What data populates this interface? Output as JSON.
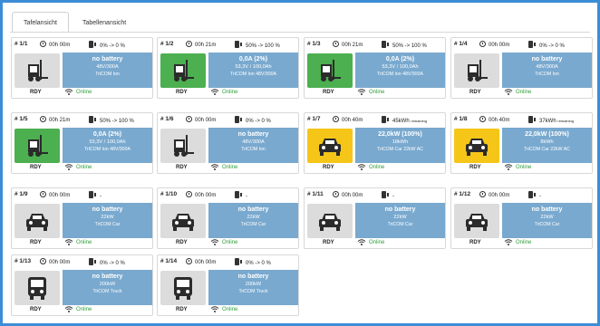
{
  "tabs": [
    {
      "label": "Tafelansicht",
      "active": true
    },
    {
      "label": "Tabellenansicht",
      "active": false
    }
  ],
  "colors": {
    "info_panel": "#79a9cf",
    "online": "#2e9e3a",
    "thumb_green": "#4caf50",
    "thumb_yellow": "#f5c518",
    "thumb_gray": "#dcdcdc",
    "frame": "#3c8dd6"
  },
  "cards": [
    {
      "id": "1/1",
      "time": "00h 00m",
      "charge": "0% -> 0 %",
      "rem": "",
      "vehicle": "forklift-icon",
      "thumb": "gray",
      "l1": "no battery",
      "l2": "48V/300A",
      "l3": "TriCOM Ion",
      "status": "RDY",
      "online": "Online"
    },
    {
      "id": "1/2",
      "time": "00h 21m",
      "charge": "50% -> 100 %",
      "rem": "",
      "vehicle": "forklift-icon",
      "thumb": "green",
      "l1": "0,0A (2%)",
      "l2": "53,3V / 100,0Ah",
      "l3": "TriCOM Ion 48V/300A",
      "status": "RDY",
      "online": "Online"
    },
    {
      "id": "1/3",
      "time": "00h 21m",
      "charge": "50% -> 100 %",
      "rem": "",
      "vehicle": "forklift-icon",
      "thumb": "green",
      "l1": "0,0A (2%)",
      "l2": "53,3V / 100,0Ah",
      "l3": "TriCOM Ion 48V/300A",
      "status": "RDY",
      "online": "Online"
    },
    {
      "id": "1/4",
      "time": "00h 00m",
      "charge": "0% -> 0 %",
      "rem": "",
      "vehicle": "forklift-icon",
      "thumb": "gray",
      "l1": "no battery",
      "l2": "48V/300A",
      "l3": "TriCOM Ion",
      "status": "RDY",
      "online": "Online"
    },
    {
      "id": "1/5",
      "time": "00h 21m",
      "charge": "50% -> 100 %",
      "rem": "",
      "vehicle": "forklift-icon",
      "thumb": "green",
      "l1": "0,0A (2%)",
      "l2": "53,3V / 100,0Ah",
      "l3": "TriCOM Ion 48V/300A",
      "status": "RDY",
      "online": "Online"
    },
    {
      "id": "1/6",
      "time": "00h 00m",
      "charge": "0% -> 0 %",
      "rem": "",
      "vehicle": "forklift-icon",
      "thumb": "gray",
      "l1": "no battery",
      "l2": "48V/300A",
      "l3": "TriCOM Ion",
      "status": "RDY",
      "online": "Online"
    },
    {
      "id": "1/7",
      "time": "00h 40m",
      "charge": "45kWh",
      "rem": "remaining",
      "vehicle": "car-icon",
      "thumb": "yellow",
      "l1": "22,0kW (100%)",
      "l2": "18kWh",
      "l3": "TriCOM Car 22kW AC",
      "status": "RDY",
      "online": "Online"
    },
    {
      "id": "1/8",
      "time": "00h 40m",
      "charge": "37kWh",
      "rem": "remaining",
      "vehicle": "car-icon",
      "thumb": "yellow",
      "l1": "22,0kW (100%)",
      "l2": "8kWh",
      "l3": "TriCOM Car 22kW AC",
      "status": "RDY",
      "online": "Online"
    },
    {
      "id": "1/9",
      "time": "00h 00m",
      "charge": "-",
      "rem": "",
      "vehicle": "car-icon",
      "thumb": "gray",
      "l1": "no battery",
      "l2": "22kW",
      "l3": "TriCOM Car",
      "status": "RDY",
      "online": "Online"
    },
    {
      "id": "1/10",
      "time": "00h 00m",
      "charge": "-",
      "rem": "",
      "vehicle": "car-icon",
      "thumb": "gray",
      "l1": "no battery",
      "l2": "22kW",
      "l3": "TriCOM Car",
      "status": "RDY",
      "online": "Online"
    },
    {
      "id": "1/11",
      "time": "00h 00m",
      "charge": "-",
      "rem": "",
      "vehicle": "car-icon",
      "thumb": "gray",
      "l1": "no battery",
      "l2": "22kW",
      "l3": "TriCOM Car",
      "status": "RDY",
      "online": "Online"
    },
    {
      "id": "1/12",
      "time": "00h 00m",
      "charge": "-",
      "rem": "",
      "vehicle": "car-icon",
      "thumb": "gray",
      "l1": "no battery",
      "l2": "22kW",
      "l3": "TriCOM Car",
      "status": "RDY",
      "online": "Online"
    },
    {
      "id": "1/13",
      "time": "00h 00m",
      "charge": "0% -> 0 %",
      "rem": "",
      "vehicle": "truck-icon",
      "thumb": "gray",
      "l1": "no battery",
      "l2": "200kW",
      "l3": "TriCOM Truck",
      "status": "RDY",
      "online": "Online"
    },
    {
      "id": "1/14",
      "time": "00h 00m",
      "charge": "0% -> 0 %",
      "rem": "",
      "vehicle": "truck-icon",
      "thumb": "gray",
      "l1": "no battery",
      "l2": "200kW",
      "l3": "TriCOM Truck",
      "status": "RDY",
      "online": "Online"
    }
  ]
}
